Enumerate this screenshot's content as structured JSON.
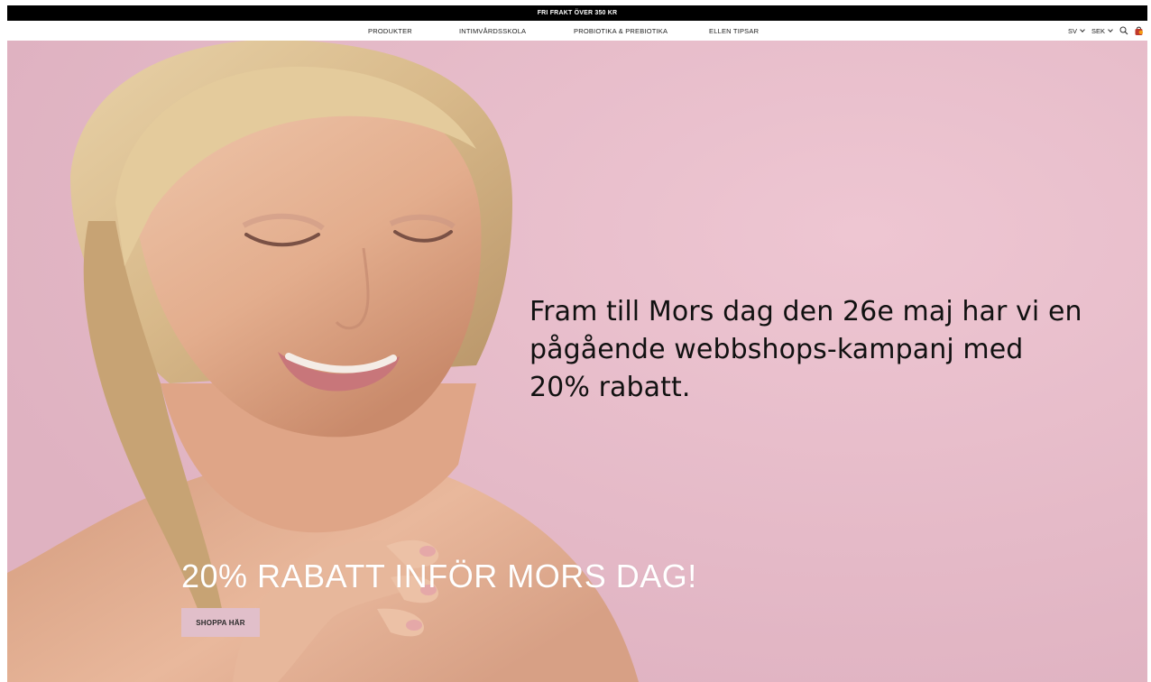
{
  "promo": {
    "text": "FRI FRAKT ÖVER 350 KR"
  },
  "nav": {
    "items": [
      {
        "label": "PRODUKTER"
      },
      {
        "label": "INTIMVÅRDSSKOLA"
      },
      {
        "label": "PROBIOTIKA & PREBIOTIKA"
      },
      {
        "label": "ELLEN TIPSAR"
      }
    ],
    "language": "SV",
    "currency": "SEK",
    "icons": {
      "search": "search-icon",
      "cart": "shopping-bag-icon"
    },
    "cart_color": "#c0392b"
  },
  "hero": {
    "body_text": "Fram till Mors dag den 26e maj har vi en pågående webbshops-kampanj med 20% rabatt.",
    "headline": "20% RABATT INFÖR MORS DAG!",
    "button_label": "SHOPPA HÄR",
    "background_color": "#e8bccb",
    "button_color": "#e1bfca"
  }
}
